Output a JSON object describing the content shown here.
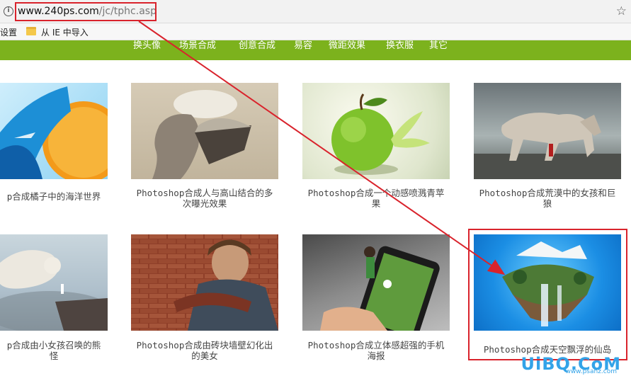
{
  "browser": {
    "info_icon": "i",
    "url_host": "www.240ps.com",
    "url_path": "/jc/tphc.asp",
    "star_icon": "☆"
  },
  "bookmarks": {
    "settings_label": "设置",
    "import_label": "从 IE 中导入"
  },
  "nav": {
    "items": [
      "换头像",
      "场景合成",
      "创意合成",
      "易容",
      "微距效果",
      "换衣服",
      "其它"
    ]
  },
  "thumbnails": [
    {
      "caption_lines": [
        "p合成橘子中的海洋世界"
      ]
    },
    {
      "caption_lines": [
        "Photoshop合成人与高山结合的多",
        "次曝光效果"
      ]
    },
    {
      "caption_lines": [
        "Photoshop合成一个动感喷溅青苹",
        "果"
      ]
    },
    {
      "caption_lines": [
        "Photoshop合成荒漠中的女孩和巨",
        "狼"
      ]
    },
    {
      "caption_lines": [
        "p合成由小女孩召唤的熊",
        "怪"
      ]
    },
    {
      "caption_lines": [
        "Photoshop合成由砖块墙壁幻化出",
        "的美女"
      ]
    },
    {
      "caption_lines": [
        "Photoshop合成立体感超强的手机",
        "海报"
      ]
    },
    {
      "caption_lines": [
        "Photoshop合成天空飘浮的仙岛"
      ]
    }
  ],
  "watermark": {
    "logo": "UiBQ.CoM",
    "sub": "www.psahz.com"
  },
  "colors": {
    "nav_green": "#7cb21d",
    "highlight_red": "#d9232c"
  }
}
